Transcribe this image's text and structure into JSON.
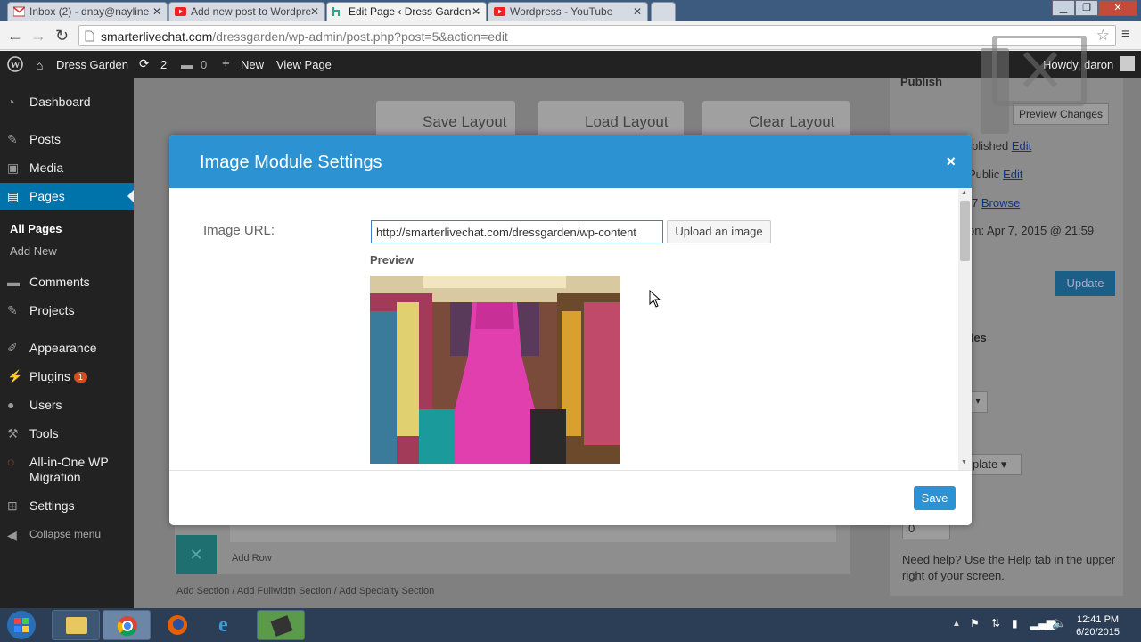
{
  "browser": {
    "tabs": [
      {
        "label": "Inbox (2) - dnay@nayline",
        "icon": "gmail-icon"
      },
      {
        "label": "Add new post to Wordpre",
        "icon": "youtube-icon"
      },
      {
        "label": "Edit Page ‹ Dress Garden –",
        "icon": "divi-icon"
      },
      {
        "label": "Wordpress - YouTube",
        "icon": "youtube-icon"
      }
    ],
    "url_host": "smarterlivechat.com",
    "url_path": "/dressgarden/wp-admin/post.php?post=5&action=edit"
  },
  "adminbar": {
    "site_name": "Dress Garden",
    "updates_count": "2",
    "comments_count": "0",
    "new_label": "New",
    "view_label": "View Page",
    "howdy": "Howdy, daron"
  },
  "sidebar": {
    "items": [
      {
        "label": "Dashboard"
      },
      {
        "label": "Posts"
      },
      {
        "label": "Media"
      },
      {
        "label": "Pages"
      },
      {
        "label": "Comments"
      },
      {
        "label": "Projects"
      },
      {
        "label": "Appearance"
      },
      {
        "label": "Plugins",
        "badge": "1"
      },
      {
        "label": "Users"
      },
      {
        "label": "Tools"
      },
      {
        "label": "All-in-One WP",
        "label2": "Migration"
      },
      {
        "label": "Settings"
      }
    ],
    "sub_items": [
      "All Pages",
      "Add New"
    ],
    "collapse": "Collapse menu"
  },
  "builder": {
    "save_layout": "Save Layout",
    "load_layout": "Load Layout",
    "clear_layout": "Clear Layout",
    "add_row": "Add Row",
    "add_section": "Add Section / Add Fullwidth Section / Add Specialty Section"
  },
  "publish_box": {
    "title": "Publish",
    "preview_changes": "Preview Changes",
    "status": "blished",
    "visibility": "Public",
    "revisions": "7",
    "browse": "Browse",
    "edit": "Edit",
    "published_on": "on: Apr 7, 2015 @ 21:59",
    "update": "Update",
    "attributes_partial": "tes",
    "template_partial": "plate",
    "order_value": "0",
    "help_line1": "Need help? Use the Help tab in the upper",
    "help_line2": "right of your screen."
  },
  "modal": {
    "title": "Image Module Settings",
    "close": "×",
    "field_label": "Image URL:",
    "url_value": "http://smarterlivechat.com/dressgarden/wp-content",
    "upload_label": "Upload an image",
    "preview_label": "Preview",
    "save_label": "Save"
  },
  "taskbar": {
    "time": "12:41 PM",
    "date": "6/20/2015"
  },
  "colors": {
    "wp_blue": "#0073aa",
    "modal_header": "#2c92d1",
    "admin_dark": "#222222"
  }
}
